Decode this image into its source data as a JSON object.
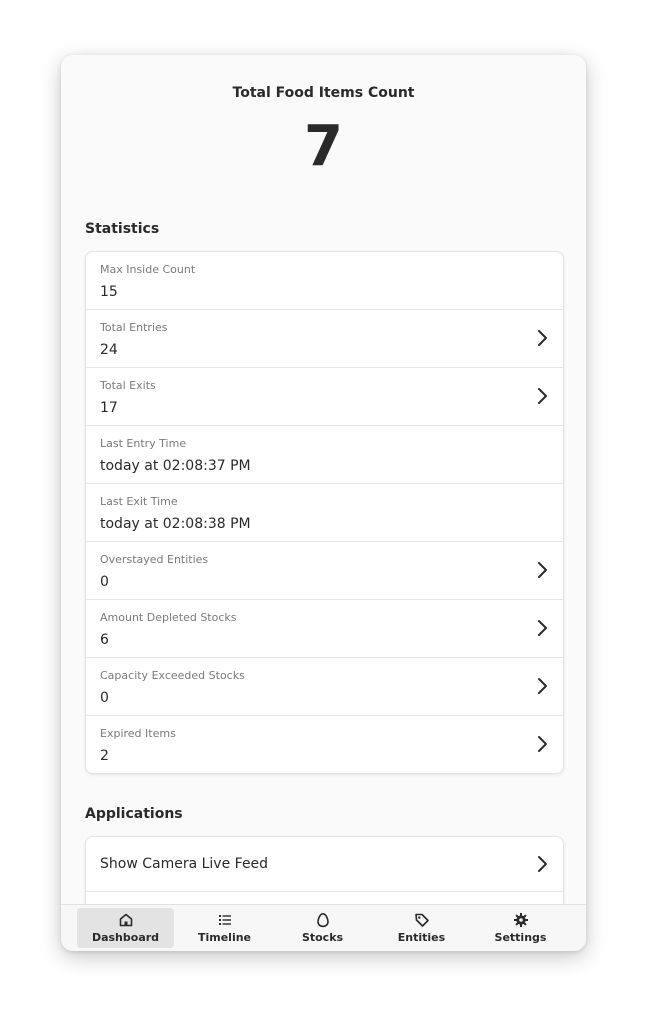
{
  "header": {
    "title": "Total Food Items Count",
    "count": "7"
  },
  "statistics": {
    "heading": "Statistics",
    "rows": [
      {
        "label": "Max Inside Count",
        "value": "15",
        "chevron": false
      },
      {
        "label": "Total Entries",
        "value": "24",
        "chevron": true
      },
      {
        "label": "Total Exits",
        "value": "17",
        "chevron": true
      },
      {
        "label": "Last Entry Time",
        "value": "today at 02:08:37 PM",
        "chevron": false
      },
      {
        "label": "Last Exit Time",
        "value": "today at 02:08:38 PM",
        "chevron": false
      },
      {
        "label": "Overstayed Entities",
        "value": "0",
        "chevron": true
      },
      {
        "label": "Amount Depleted Stocks",
        "value": "6",
        "chevron": true
      },
      {
        "label": "Capacity Exceeded Stocks",
        "value": "0",
        "chevron": true
      },
      {
        "label": "Expired Items",
        "value": "2",
        "chevron": true
      }
    ]
  },
  "applications": {
    "heading": "Applications",
    "items": [
      {
        "label": "Show Camera Live Feed",
        "chevron": true
      }
    ]
  },
  "tabbar": {
    "tabs": [
      {
        "label": "Dashboard",
        "icon": "home-icon",
        "active": true
      },
      {
        "label": "Timeline",
        "icon": "list-icon",
        "active": false
      },
      {
        "label": "Stocks",
        "icon": "egg-icon",
        "active": false
      },
      {
        "label": "Entities",
        "icon": "tag-icon",
        "active": false
      },
      {
        "label": "Settings",
        "icon": "gear-icon",
        "active": false
      }
    ]
  },
  "colors": {
    "text": "#2a2a2a",
    "muted": "#7a7a7a",
    "active_tab_bg": "#e3e3e3"
  }
}
